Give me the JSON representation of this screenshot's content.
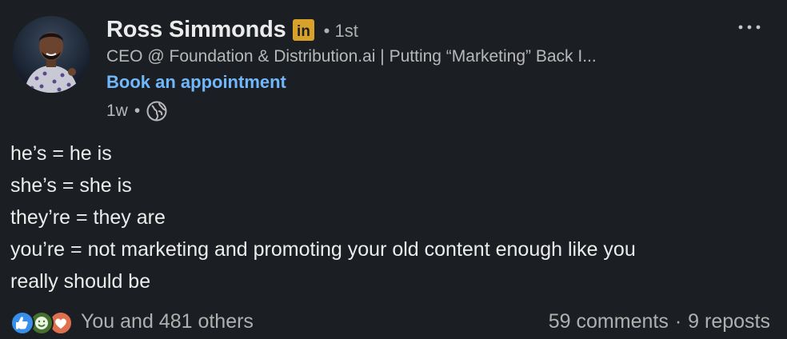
{
  "author": {
    "name": "Ross Simmonds",
    "badge": "in",
    "degree": "1st",
    "headline": "CEO @ Foundation & Distribution.ai | Putting “Marketing” Back I...",
    "cta": "Book an appointment",
    "time": "1w",
    "visibility_icon": "globe-icon"
  },
  "post": {
    "lines": [
      "he’s = he is",
      "she’s = she is",
      "they’re = they are",
      "you’re = not marketing and promoting your old content enough like you",
      "really should be"
    ]
  },
  "engagement": {
    "reaction_icons": [
      "like-icon",
      "celebrate-icon",
      "love-icon"
    ],
    "reactions_text": "You and 481 others",
    "comments": "59 comments",
    "reposts": "9 reposts",
    "separator": "•"
  },
  "colors": {
    "background": "#1b1f23",
    "link": "#71b7fb",
    "badge": "#d8a12a",
    "like": "#378fe9",
    "celebrate": "#44712e",
    "love": "#df704d"
  }
}
